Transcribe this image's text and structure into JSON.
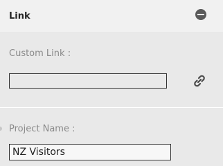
{
  "panel": {
    "title": "Link"
  },
  "custom_link": {
    "label": "Custom Link :",
    "value": ""
  },
  "project": {
    "label": "Project Name :",
    "value": "NZ Visitors"
  },
  "icons": {
    "collapse": "minus-circle-icon",
    "link": "link-icon"
  },
  "colors": {
    "panel_bg": "#e9e9e9",
    "header_bg": "#f1f1f1",
    "label": "#8a8a8a"
  }
}
